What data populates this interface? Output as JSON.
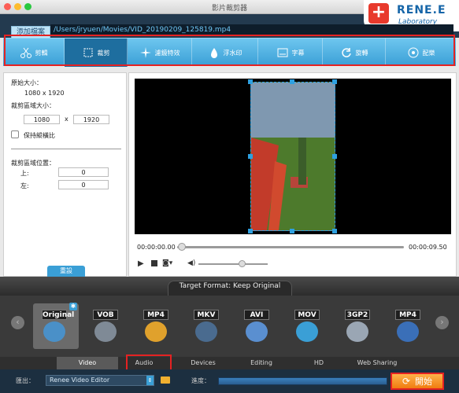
{
  "window": {
    "title": "影片裁剪器"
  },
  "brand": {
    "name": "RENE.E",
    "sub": "Laboratory"
  },
  "pathbar": {
    "add_file": "添加檔案",
    "path": "/Users/jryuen/Movies/VID_20190209_125819.mp4"
  },
  "toolbar": [
    {
      "label": "剪輯",
      "icon": "scissors-icon"
    },
    {
      "label": "裁剪",
      "icon": "crop-icon"
    },
    {
      "label": "濾鏡特效",
      "icon": "sparkle-icon"
    },
    {
      "label": "浮水印",
      "icon": "watermark-icon"
    },
    {
      "label": "字幕",
      "icon": "subtitle-icon"
    },
    {
      "label": "旋轉",
      "icon": "rotate-icon"
    },
    {
      "label": "配樂",
      "icon": "music-icon"
    }
  ],
  "left": {
    "orig_label": "原始大小：",
    "orig_value": "1080 x 1920",
    "crop_label": "裁剪區域大小：",
    "crop_w": "1080",
    "crop_x": "x",
    "crop_h": "1920",
    "keep_ratio": "保持縱橫比",
    "pos_label": "裁剪區域位置：",
    "top_label": "上:",
    "top_value": "0",
    "left_label": "左:",
    "left_value": "0",
    "reset": "重設"
  },
  "player": {
    "time_start": "00:00:00.00",
    "time_end": "00:00:09.50"
  },
  "target_format": "Target Format: Keep Original",
  "formats": [
    {
      "tag": "Original",
      "color": "#4a90c8"
    },
    {
      "tag": "VOB",
      "color": "#7f8a96"
    },
    {
      "tag": "MP4",
      "color": "#e0a12c"
    },
    {
      "tag": "MKV",
      "color": "#4a6b8f"
    },
    {
      "tag": "AVI",
      "color": "#5a8fd0"
    },
    {
      "tag": "MOV",
      "color": "#3a9fd6"
    },
    {
      "tag": "3GP2",
      "color": "#9aa6b4"
    },
    {
      "tag": "MP4",
      "color": "#3a6fb8"
    }
  ],
  "categories": [
    "Video",
    "Audio",
    "Devices",
    "Editing",
    "HD",
    "Web Sharing"
  ],
  "footer": {
    "output_label": "匯出：",
    "output_value": "Renee Video Editor",
    "progress_label": "進度：",
    "start": "開始"
  }
}
